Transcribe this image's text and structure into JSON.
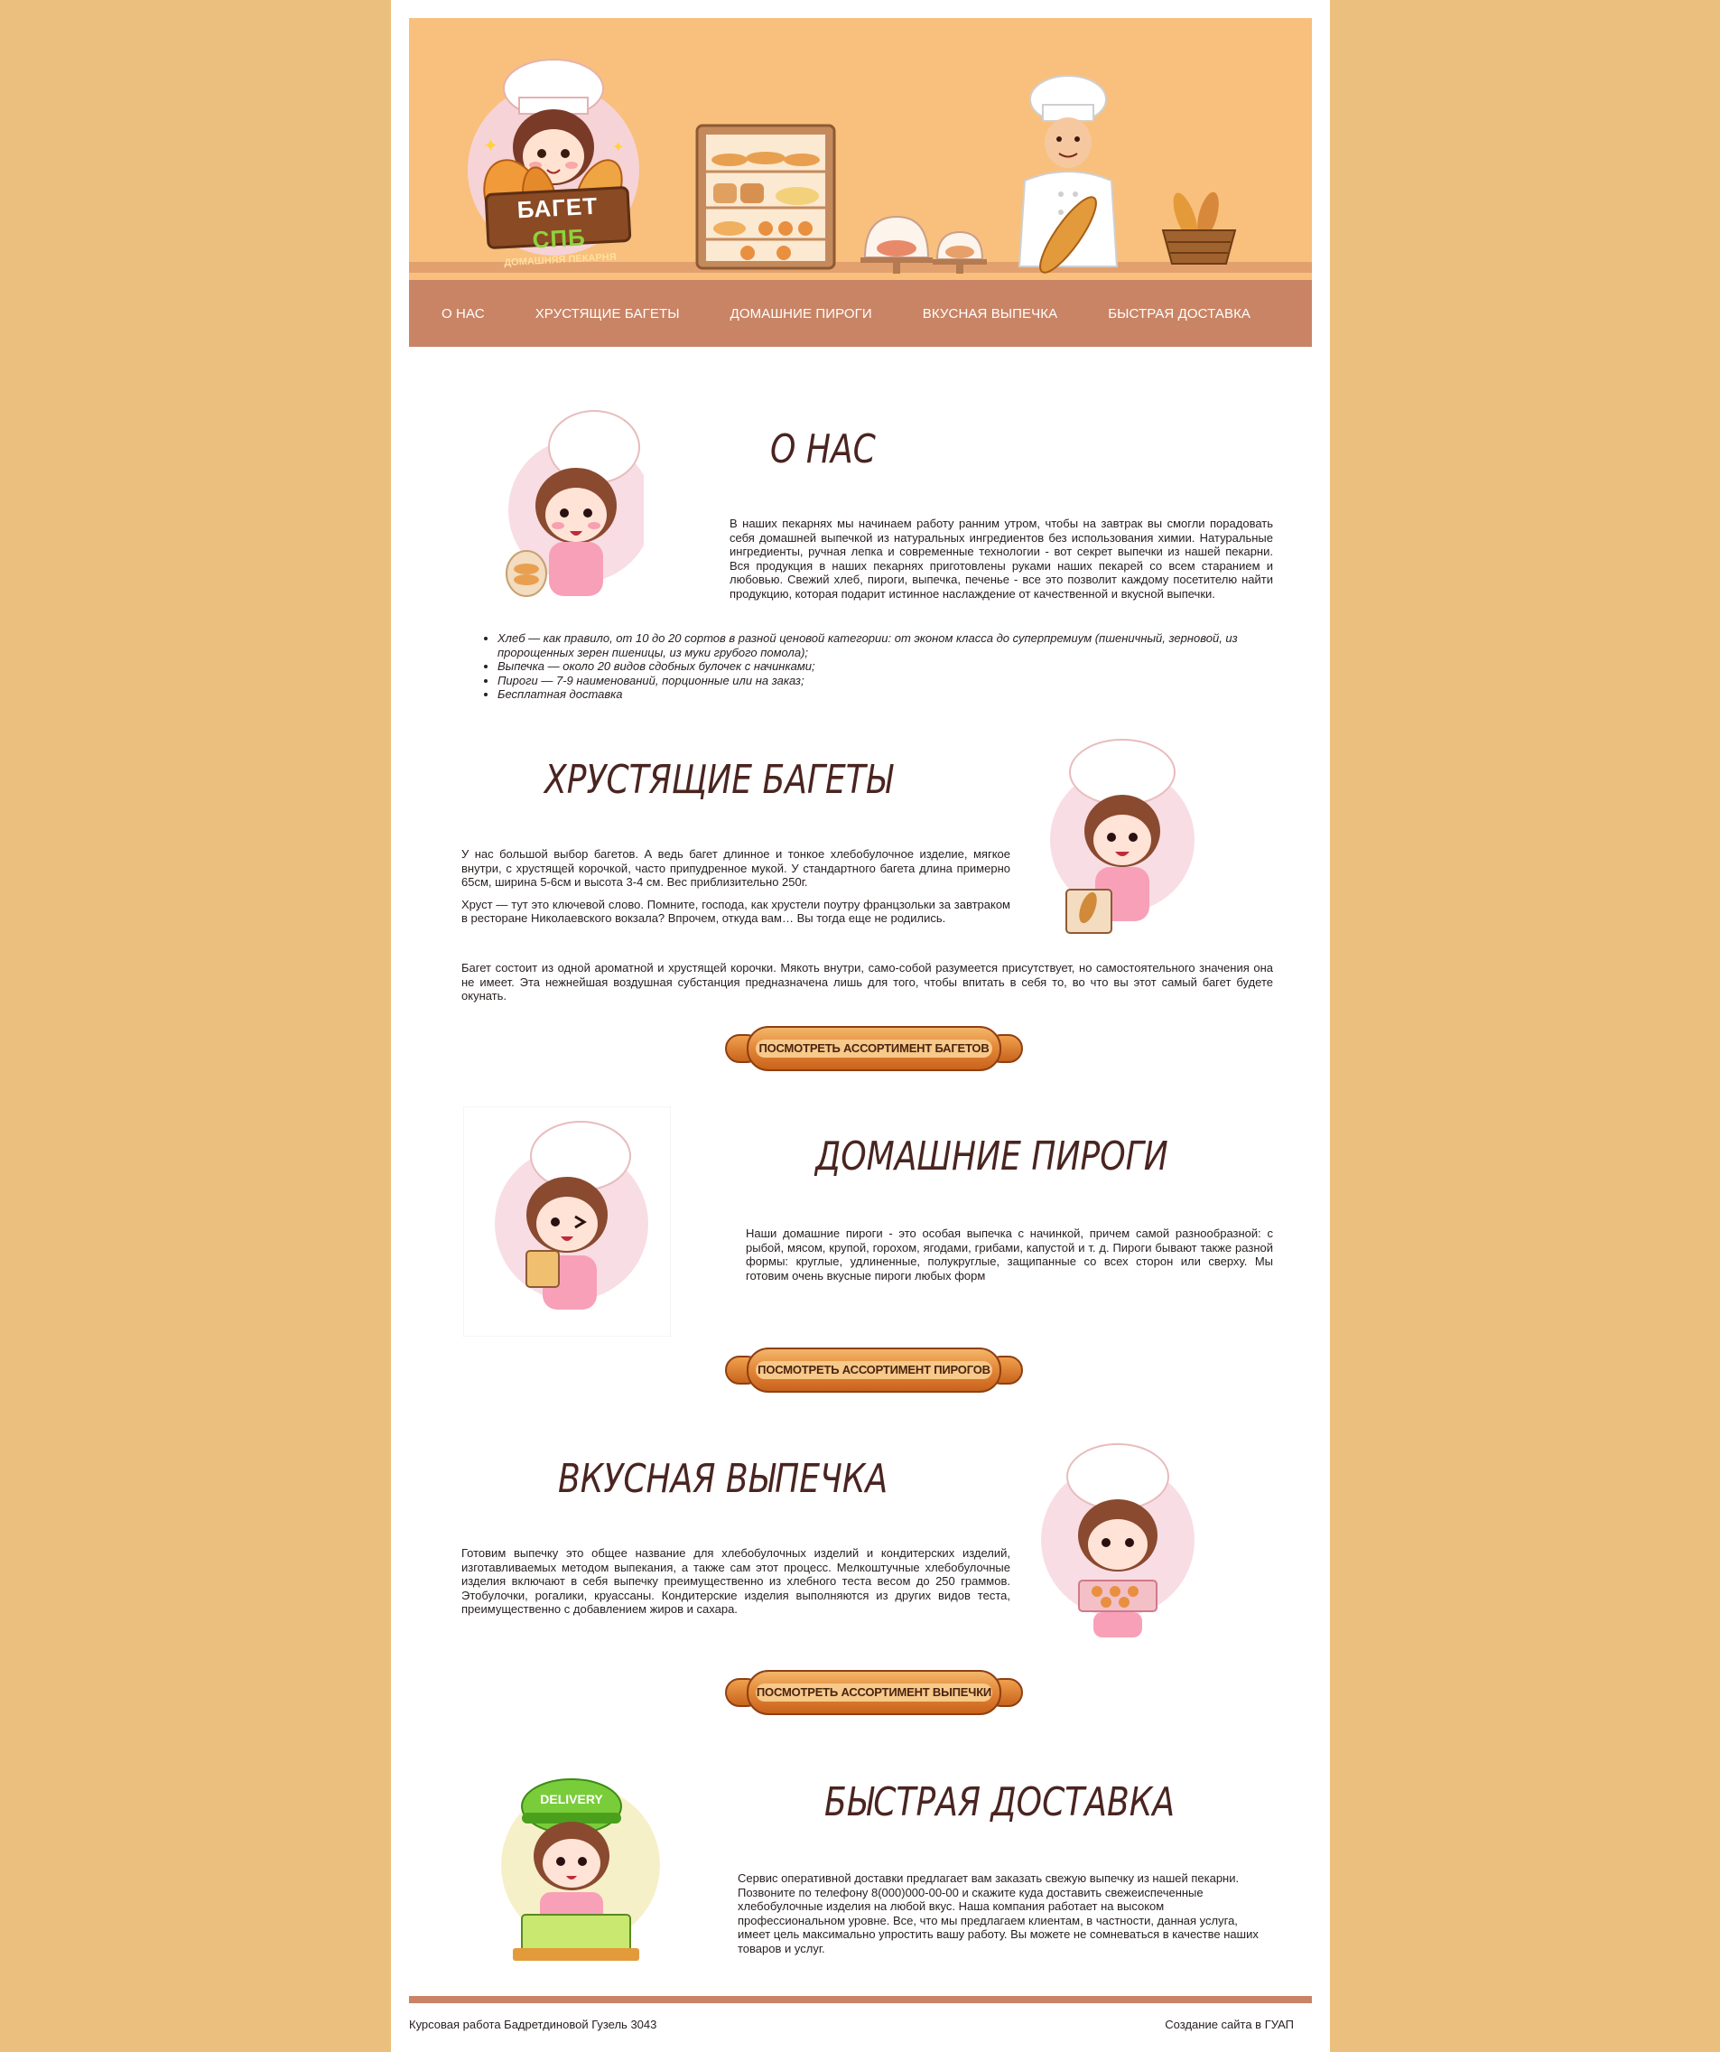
{
  "nav": {
    "items": [
      "О НАС",
      "ХРУСТЯЩИЕ БАГЕТЫ",
      "ДОМАШНИЕ ПИРОГИ",
      "ВКУСНАЯ ВЫПЕЧКА",
      "БЫСТРАЯ ДОСТАВКА"
    ]
  },
  "logo": {
    "brand_main": "БАГЕТ",
    "brand_accent": "СПБ",
    "subtitle": "ДОМАШНЯЯ ПЕКАРНЯ"
  },
  "about": {
    "title": "О НАС",
    "text": "В наших пекарнях мы начинаем работу ранним утром, чтобы на завтрак вы смогли порадовать себя домашней выпечкой из натуральных ингредиентов без использования химии. Натуральные ингредиенты, ручная лепка и современные технологии - вот секрет выпечки из нашей пекарни. Вся продукция в наших пекарнях приготовлены руками наших пекарей со всем старанием и любовью. Свежий хлеб, пироги, выпечка, печенье - все это позволит каждому посетителю найти продукцию, которая подарит истинное наслаждение от качественной и вкусной выпечки.",
    "list": [
      "Хлеб — как правило, от 10 до 20 сортов в разной ценовой категории: от эконом класса до суперпремиум (пшеничный, зерновой, из пророщенных зерен пшеницы, из муки грубого помола);",
      "Выпечка — около 20 видов сдобных булочек с начинками;",
      "Пироги — 7-9 наименований, порционные или на заказ;",
      "Бесплатная доставка"
    ]
  },
  "baguettes": {
    "title": "ХРУСТЯЩИЕ БАГЕТЫ",
    "p1": "У нас большой выбор багетов. А ведь багет длинное и тонкое хлебобулочное изделие, мягкое внутри, с хрустящей корочкой, часто припудренное мукой. У стандартного багета длина примерно 65см, ширина 5-6см и высота 3-4 см. Вес приблизительно 250г.",
    "p2": "Хруст — тут это ключевой слово. Помните, господа, как хрустели поутру францзольки за завтраком в ресторане Николаевского вокзала? Впрочем, откуда вам… Вы тогда еще не родились.",
    "p3": "Багет состоит из одной ароматной и хрустящей корочки. Мякоть внутри, само-собой разумеется присутствует, но самостоятельного значения она не имеет. Эта нежнейшая воздушная субстанция предназначена лишь для того, чтобы впитать в себя то, во что вы этот самый багет будете окунать.",
    "button": "ПОСМОТРЕТЬ АССОРТИМЕНТ БАГЕТОВ"
  },
  "pies": {
    "title": "ДОМАШНИЕ ПИРОГИ",
    "text": "Наши домашние пироги - это особая выпечка с начинкой, причем самой разнообразной: с рыбой, мясом, крупой, горохом, ягодами, грибами, капустой и т. д. Пироги бывают также разной формы: круглые, удлиненные, полукруглые, защипанные со всех сторон или сверху. Мы готовим очень вкусные пироги любых форм",
    "button": "ПОСМОТРЕТЬ АССОРТИМЕНТ ПИРОГОВ"
  },
  "pastry": {
    "title": "ВКУСНАЯ ВЫПЕЧКА",
    "text": "Готовим выпечку это общее название для хлебобулочных изделий и кондитерских изделий, изготавливаемых методом выпекания, а также сам этот процесс. Мелкоштучные хлебобулочные изделия включают в себя выпечку преимущественно из хлебного теста весом до 250 граммов. Этобулочки, рогалики, круассаны. Кондитерские изделия выполняются из других видов теста, преимущественно с добавлением жиров и сахара.",
    "button": "ПОСМОТРЕТЬ АССОРТИМЕНТ ВЫПЕЧКИ"
  },
  "delivery": {
    "title": "БЫСТРАЯ ДОСТАВКА",
    "cap_text": "DELIVERY",
    "text": "Сервис оперативной доставки предлагает вам заказать свежую выпечку из нашей пекарни. Позвоните по телефону 8(000)000-00-00 и скажите куда доставить свежеиспеченные хлебобулочные изделия на любой вкус. Наша компания работает на высоком профессиональном уровне. Все, что мы предлагаем клиентам, в частности, данная услуга, имеет цель максимально упростить вашу работу. Вы можете не сомневаться в качестве наших товаров и услуг."
  },
  "footer": {
    "left": "Курсовая работа Бадретдиновой Гузель 3043",
    "right": "Создание сайта в ГУАП"
  },
  "colors": {
    "page_bg": "#ebbf7d",
    "header_bg": "#f8c07c",
    "nav_bg": "#c98465",
    "title_color": "#4a2420"
  }
}
